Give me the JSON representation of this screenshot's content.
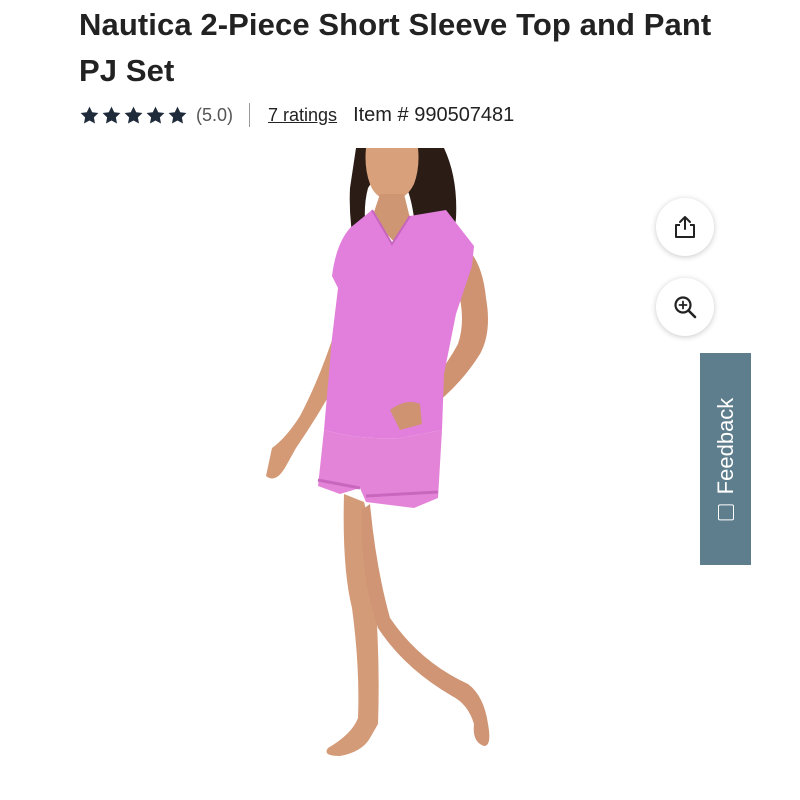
{
  "product": {
    "title": "Nautica 2-Piece Short Sleeve Top and Pant PJ Set",
    "rating_value": 5.0,
    "rating_text": "(5.0)",
    "stars_filled": 5,
    "ratings_link": "7 ratings",
    "item_number": "Item # 990507481"
  },
  "image": {
    "subject": "model-in-pink-short-sleeve-pajama-set",
    "top_color": "#e27fdc",
    "shorts_color": "#e484d9"
  },
  "actions": {
    "share_icon": "share-icon",
    "zoom_icon": "zoom-in-icon"
  },
  "feedback": {
    "label": "Feedback",
    "icon": "[+]",
    "color": "#5e7d8d"
  },
  "colors": {
    "star": "#1f2b3a",
    "text": "#222222"
  }
}
